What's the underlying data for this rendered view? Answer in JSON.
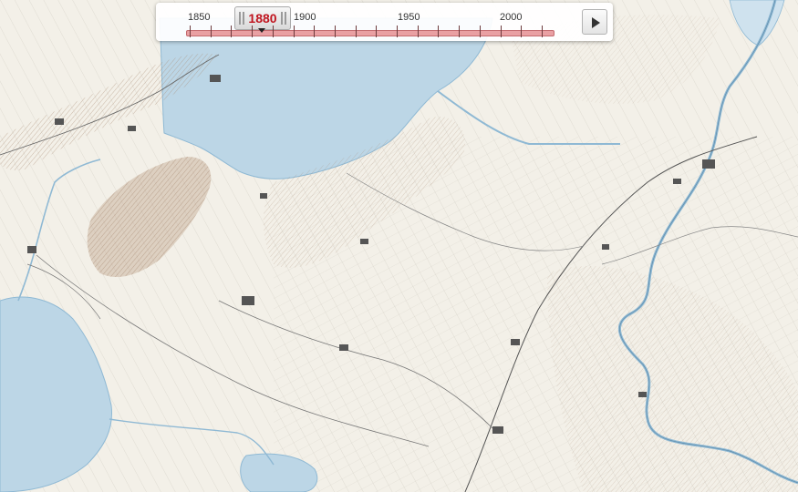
{
  "time_slider": {
    "current_year": "1880",
    "scale_labels": [
      "1850",
      "1900",
      "1950",
      "2000"
    ],
    "play_icon": "play-icon",
    "handle_color": "#c0151f",
    "track_color": "#e9a0a3"
  },
  "map": {
    "lake_color": "#bcd6e6",
    "river_color": "#8fb9d4",
    "terrain_color": "#c4a892",
    "paper_color": "#f3f0e8"
  }
}
